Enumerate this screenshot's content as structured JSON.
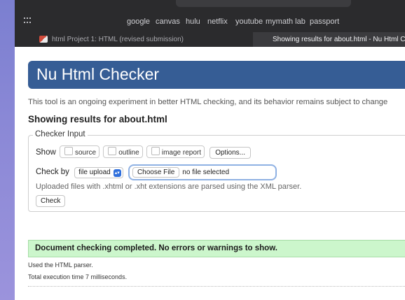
{
  "browser": {
    "bookmarks": [
      "google",
      "canvas",
      "hulu",
      "netflix",
      "youtube",
      "mymath lab",
      "passport"
    ],
    "tabs": [
      {
        "label": "html Project 1: HTML (revised submission)",
        "active": false
      },
      {
        "label": "Showing results for about.html - Nu Html Ch",
        "active": true
      }
    ]
  },
  "page": {
    "title": "Nu Html Checker",
    "intro": "This tool is an ongoing experiment in better HTML checking, and its behavior remains subject to change",
    "results_heading": "Showing results for about.html",
    "checker_input": {
      "legend": "Checker Input",
      "show_label": "Show",
      "options": [
        {
          "label": "source",
          "checked": false
        },
        {
          "label": "outline",
          "checked": false
        },
        {
          "label": "image report",
          "checked": false
        }
      ],
      "options_button": "Options...",
      "check_by_label": "Check by",
      "check_by_selected": "file upload",
      "choose_file_button": "Choose File",
      "file_status": "no file selected",
      "note": "Uploaded files with .xhtml or .xht extensions are parsed using the XML parser.",
      "check_button": "Check"
    },
    "success_message": "Document checking completed. No errors or warnings to show.",
    "parser_info": "Used the HTML parser.",
    "execution_time": "Total execution time 7 milliseconds."
  },
  "colors": {
    "header_banner": "#365d95",
    "success_bg": "#ccf6cc",
    "focus_ring": "#8fb1e3",
    "select_arrow": "#2f6fdc",
    "chrome_bg": "#2b2b2d"
  }
}
